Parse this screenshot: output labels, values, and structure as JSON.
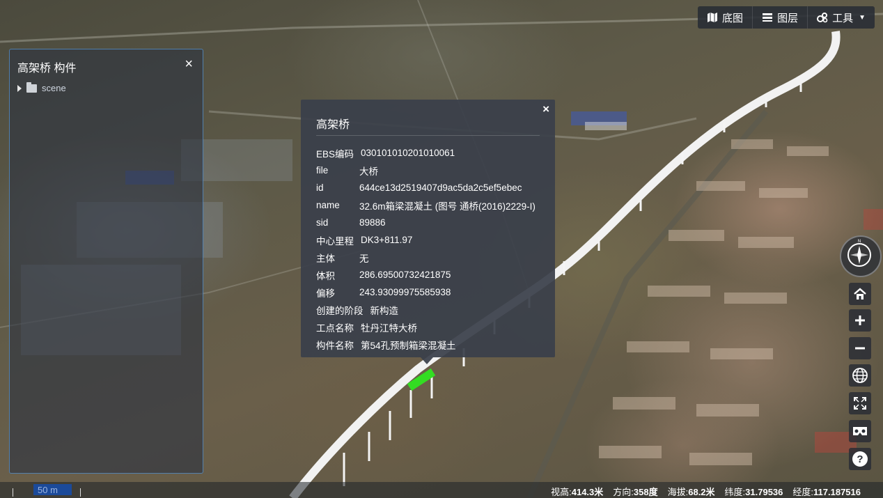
{
  "toolbar": {
    "basemap_label": "底图",
    "layers_label": "图层",
    "tools_label": "工具"
  },
  "tree_panel": {
    "title": "高架桥 构件",
    "close_glyph": "×",
    "root_label": "scene"
  },
  "popup": {
    "title": "高架桥",
    "close_glyph": "×",
    "rows": [
      {
        "key": "EBS编码",
        "value": "030101010201010061"
      },
      {
        "key": "file",
        "value": "大桥"
      },
      {
        "key": "id",
        "value": "644ce13d2519407d9ac5da2c5ef5ebec"
      },
      {
        "key": "name",
        "value": "32.6m箱梁混凝土 (图号 通桥(2016)2229-I)"
      },
      {
        "key": "sid",
        "value": "89886"
      },
      {
        "key": "中心里程",
        "value": "DK3+811.97"
      },
      {
        "key": "主体",
        "value": "无"
      },
      {
        "key": "体积",
        "value": "286.69500732421875"
      },
      {
        "key": "偏移",
        "value": "243.93099975585938"
      },
      {
        "key": "创建的阶段",
        "value": "新构造"
      },
      {
        "key": "工点名称",
        "value": "牡丹江特大桥"
      },
      {
        "key": "构件名称",
        "value": "第54孔预制箱梁混凝土"
      }
    ]
  },
  "nav_controls": {
    "icons": [
      "compass-icon",
      "home-icon",
      "zoom-in-icon",
      "zoom-out-icon",
      "globe-icon",
      "fullscreen-icon",
      "vr-icon",
      "help-icon"
    ]
  },
  "statusbar": {
    "scale_label": "50 m",
    "view_height_label": "视高:",
    "view_height_value": "414.3米",
    "heading_label": "方向:",
    "heading_value": "358度",
    "altitude_label": "海拔:",
    "altitude_value": "68.2米",
    "lat_label": "纬度:",
    "lat_value": "31.79536",
    "lon_label": "经度:",
    "lon_value": "117.187516"
  },
  "colors": {
    "panel_bg": "#2d3440",
    "panel_border": "#5a96d2",
    "popup_bg": "#3a404a",
    "highlight_green": "#33dd22",
    "bridge_white": "#f2f2f2"
  }
}
